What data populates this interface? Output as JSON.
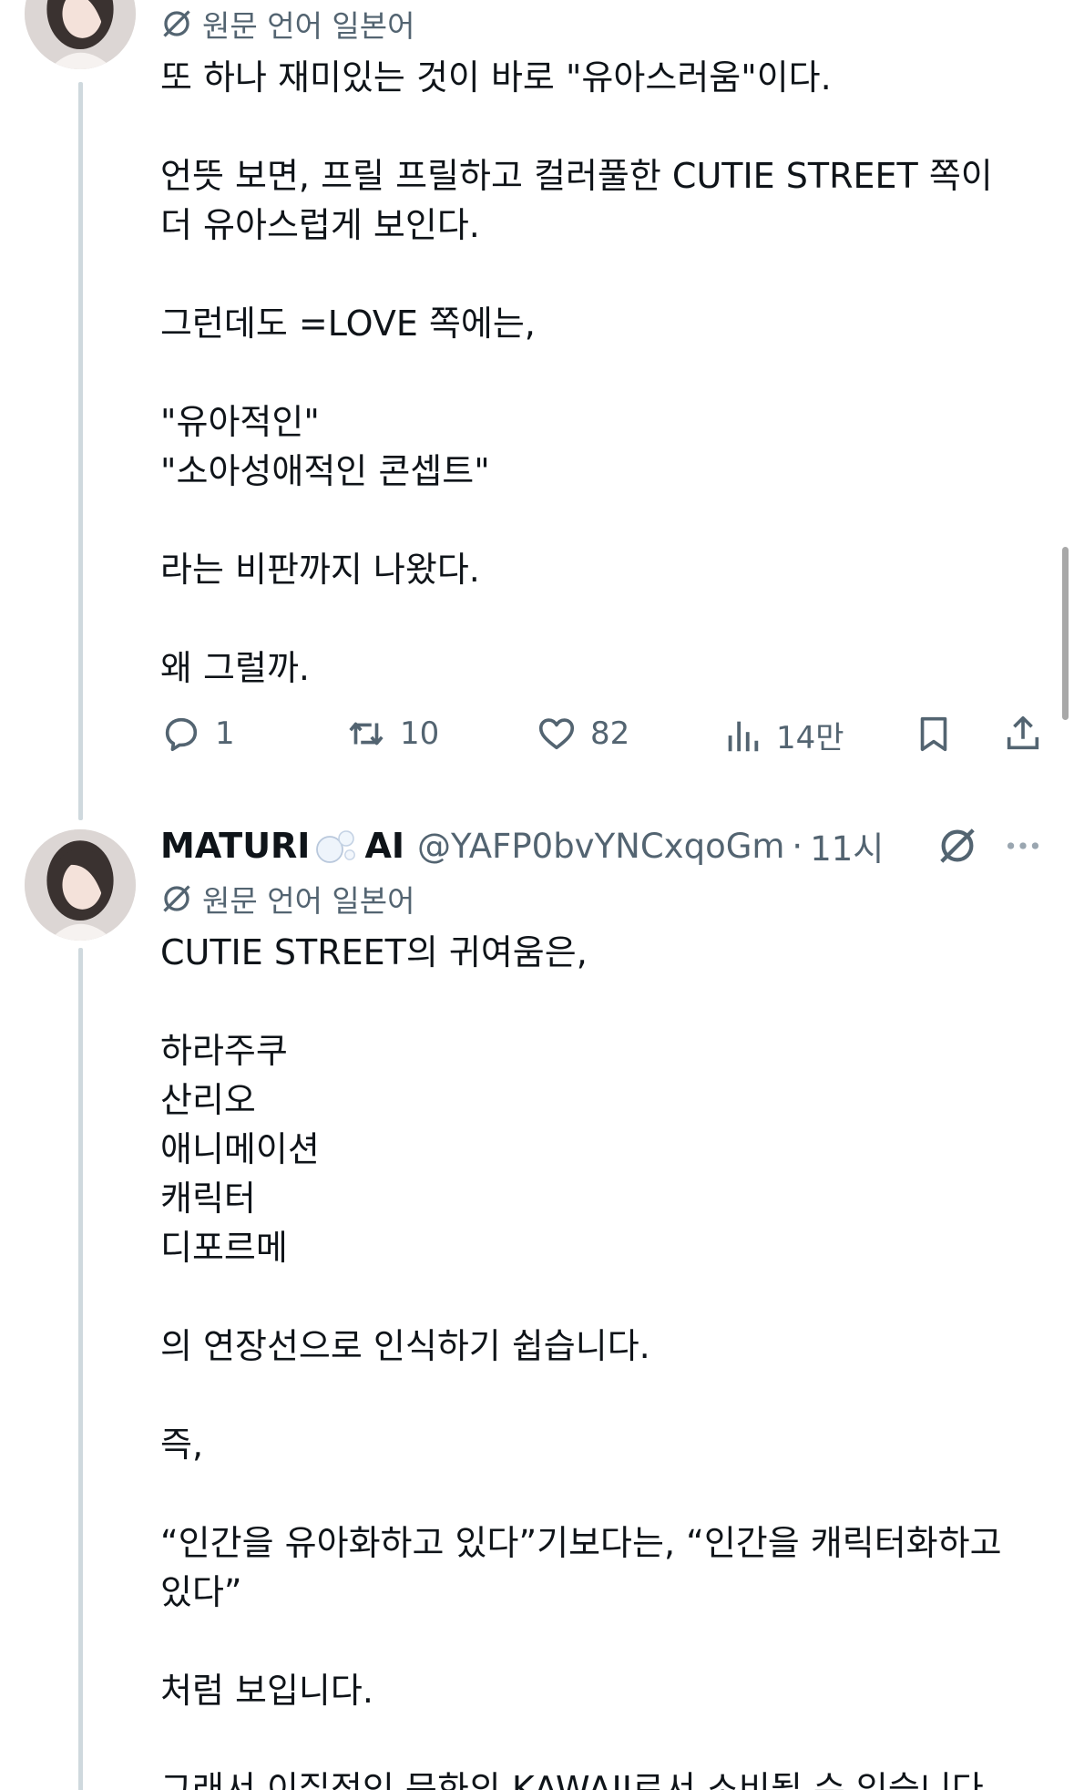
{
  "tweet1": {
    "translation_label": "원문 언어 일본어",
    "lines": [
      "또 하나 재미있는 것이 바로 \"유아스러움\"이다.",
      "",
      "언뜻 보면, 프릴 프릴하고 컬러풀한 CUTIE STREET 쪽이",
      "더 유아스럽게 보인다.",
      "",
      "그런데도 =LOVE 쪽에는,",
      "",
      "\"유아적인\"",
      "\"소아성애적인 콘셉트\"",
      "",
      "라는 비판까지 나왔다.",
      "",
      "왜 그럴까."
    ],
    "actions": {
      "reply_icon": "reply-icon",
      "reply_count": "1",
      "retweet_icon": "retweet-icon",
      "retweet_count": "10",
      "like_icon": "heart-icon",
      "like_count": "82",
      "views_icon": "views-icon",
      "views_count": "14만",
      "bookmark_icon": "bookmark-icon",
      "share_icon": "share-icon"
    }
  },
  "tweet2": {
    "display_name": "MATURI",
    "display_name_suffix": "AI",
    "handle": "@YAFP0bvYNCxqoGm",
    "separator": "·",
    "time": "11시",
    "translation_label": "원문 언어 일본어",
    "lines": [
      "CUTIE STREET의 귀여움은,",
      "",
      "하라주쿠",
      "산리오",
      "애니메이션",
      "캐릭터",
      "디포르메",
      "",
      "의 연장선으로 인식하기 쉽습니다.",
      "",
      "즉,",
      "",
      "“인간을 유아화하고 있다”기보다는, “인간을 캐릭터화하고",
      "있다”",
      "",
      "처럼 보입니다.",
      "",
      "그래서 이질적인 문화의 KAWAII로서 소비될 수 있습니다."
    ]
  },
  "colors": {
    "text": "#0f1419",
    "muted": "#536471",
    "thread_line": "#cfd9de"
  }
}
